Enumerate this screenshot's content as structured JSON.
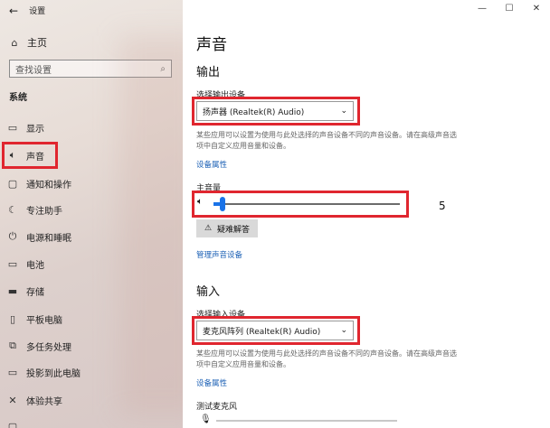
{
  "window": {
    "title": "设置",
    "controls": [
      "—",
      "☐",
      "✕"
    ]
  },
  "sidebar": {
    "home_label": "主页",
    "search_placeholder": "查找设置",
    "section_label": "系统",
    "items": [
      {
        "label": "显示",
        "icon": "display-icon",
        "active": false
      },
      {
        "label": "声音",
        "icon": "speaker-icon",
        "active": true
      },
      {
        "label": "通知和操作",
        "icon": "notification-icon",
        "active": false
      },
      {
        "label": "专注助手",
        "icon": "moon-icon",
        "active": false
      },
      {
        "label": "电源和睡眠",
        "icon": "power-icon",
        "active": false
      },
      {
        "label": "电池",
        "icon": "battery-icon",
        "active": false
      },
      {
        "label": "存储",
        "icon": "storage-icon",
        "active": false
      },
      {
        "label": "平板电脑",
        "icon": "tablet-icon",
        "active": false
      },
      {
        "label": "多任务处理",
        "icon": "multitask-icon",
        "active": false
      },
      {
        "label": "投影到此电脑",
        "icon": "project-icon",
        "active": false
      },
      {
        "label": "体验共享",
        "icon": "share-icon",
        "active": false
      }
    ]
  },
  "main": {
    "title": "声音",
    "output": {
      "heading": "输出",
      "device_label": "选择输出设备",
      "device_value": "扬声器 (Realtek(R) Audio)",
      "description": "某些应用可以设置为使用与此处选择的声音设备不同的声音设备。请在高级声音选项中自定义应用音量和设备。",
      "properties_link": "设备属性",
      "volume_label": "主音量",
      "volume_value": 5,
      "volume_value_text": "5",
      "troubleshoot_label": "疑难解答",
      "manage_link": "管理声音设备"
    },
    "input": {
      "heading": "输入",
      "device_label": "选择输入设备",
      "device_value": "麦克风阵列 (Realtek(R) Audio)",
      "description": "某些应用可以设置为使用与此处选择的声音设备不同的声音设备。请在高级声音选项中自定义应用音量和设备。",
      "properties_link": "设备属性",
      "mic_test_label": "测试麦克风"
    }
  },
  "colors": {
    "accent": "#1a73e8",
    "highlight": "#e0262f",
    "link": "#1a5fb4"
  }
}
